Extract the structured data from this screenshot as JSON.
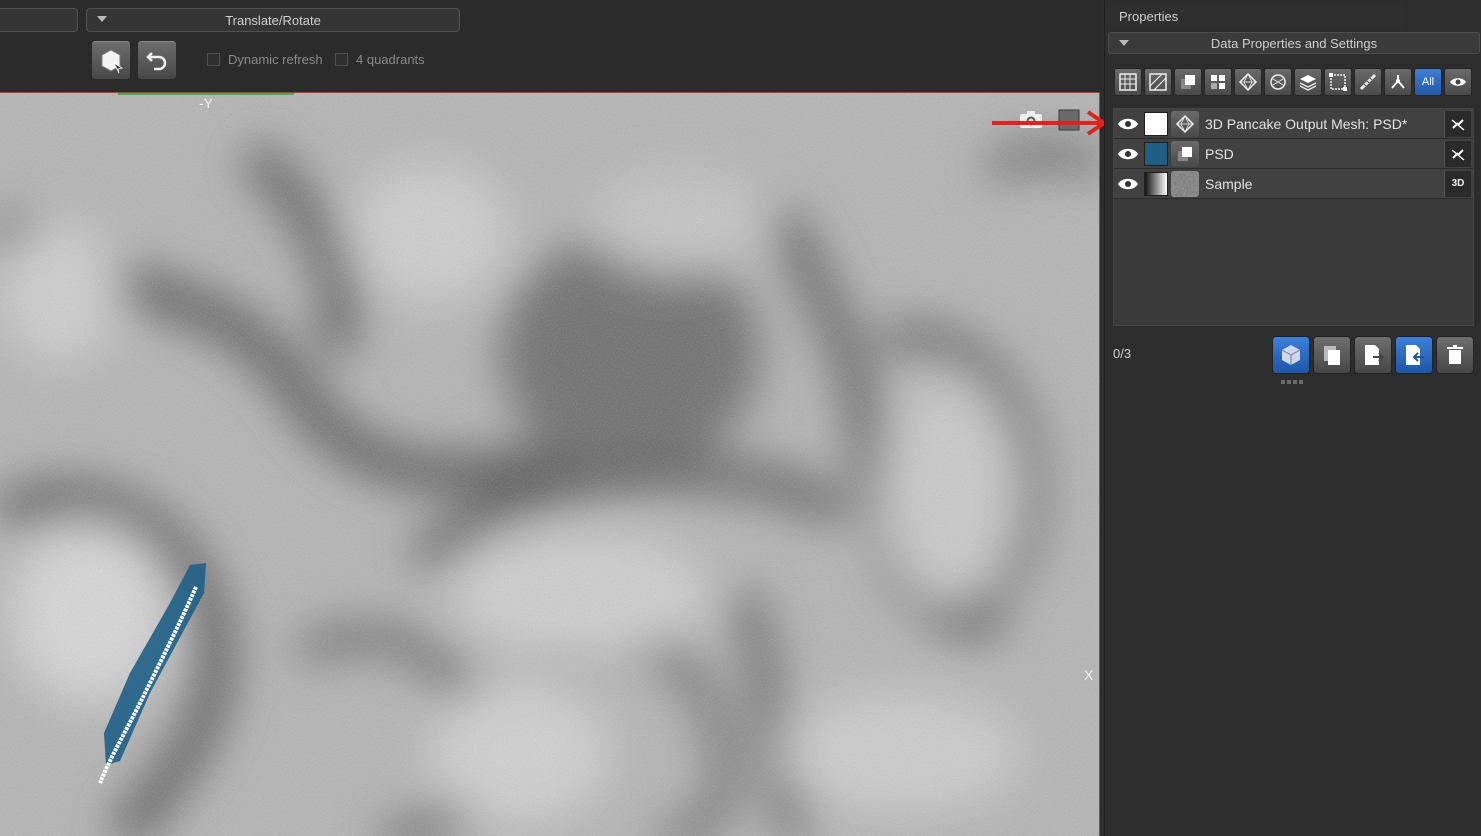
{
  "toolbar": {
    "mode_dropdown": "Translate/Rotate",
    "dynamic_refresh": "Dynamic refresh",
    "four_quadrants": "4 quadrants"
  },
  "viewport": {
    "top_axis_label": "-Y",
    "right_axis_label": "X"
  },
  "properties": {
    "panel_title": "Properties",
    "section_title": "Data Properties and Settings",
    "filter_all_label": "All",
    "items": [
      {
        "name": "3D Pancake Output Mesh: PSD*",
        "swatch_color": "#ffffff",
        "icon": "mesh-icon",
        "tag_icon": "unlink-icon"
      },
      {
        "name": "PSD",
        "swatch_color": "#1f5f86",
        "icon": "volume-icon",
        "tag_icon": "unlink-icon"
      },
      {
        "name": "Sample",
        "swatch_color": "gradient",
        "icon": "image-thumbnail",
        "tag": "3D"
      }
    ],
    "selection_count": "0/3"
  },
  "colors": {
    "accent_blue": "#2d6cc4",
    "annotation_red": "#e0231f",
    "segment_blue": "#1f5f86"
  }
}
